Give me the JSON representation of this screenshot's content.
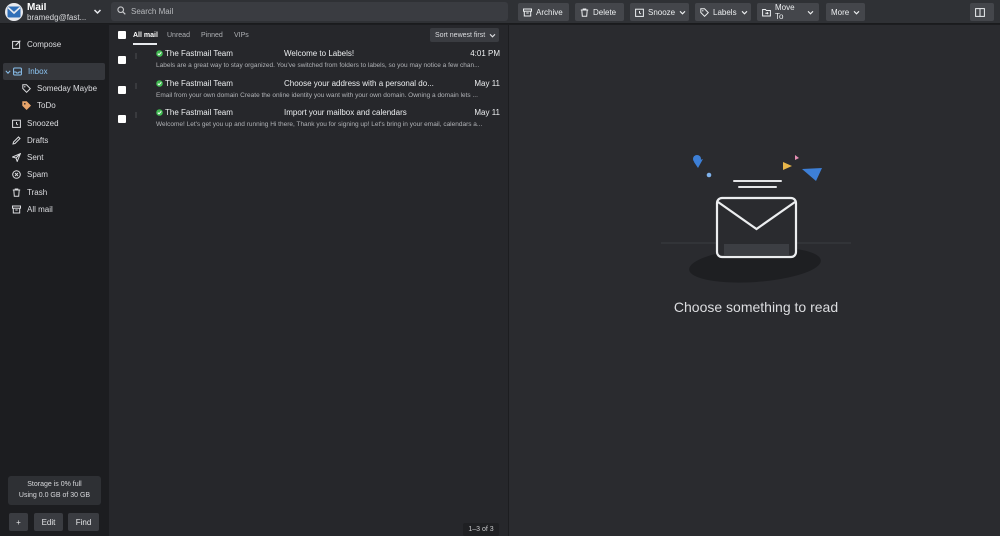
{
  "app": {
    "title": "Mail",
    "account_email": "bramedg@fast..."
  },
  "search": {
    "placeholder": "Search Mail"
  },
  "toolbar": {
    "archive": "Archive",
    "delete": "Delete",
    "snooze": "Snooze",
    "labels": "Labels",
    "move_to": "Move To",
    "more": "More"
  },
  "sidebar": {
    "compose": "Compose",
    "items": [
      {
        "label": "Inbox",
        "icon": "inbox-icon",
        "active": true
      },
      {
        "label": "Someday Maybe",
        "icon": "tag-icon"
      },
      {
        "label": "ToDo",
        "icon": "tag-icon",
        "color": "#e8a46a"
      },
      {
        "label": "Snoozed",
        "icon": "clock-icon"
      },
      {
        "label": "Drafts",
        "icon": "pencil-icon"
      },
      {
        "label": "Sent",
        "icon": "paper-plane-icon"
      },
      {
        "label": "Spam",
        "icon": "spam-icon"
      },
      {
        "label": "Trash",
        "icon": "trash-icon"
      },
      {
        "label": "All mail",
        "icon": "archive-box-icon"
      }
    ],
    "storage_line1": "Storage is 0% full",
    "storage_line2": "Using 0.0 GB of 30 GB",
    "add_button": "+",
    "edit_button": "Edit",
    "find_button": "Find"
  },
  "list": {
    "filters": [
      "All mail",
      "Unread",
      "Pinned",
      "VIPs"
    ],
    "sort_label": "Sort newest first",
    "messages": [
      {
        "sender": "The Fastmail Team",
        "subject": "Welcome to Labels!",
        "date": "4:01 PM",
        "preview": "Labels are a great way to stay organized. You've switched from folders to labels, so you may notice a few chan..."
      },
      {
        "sender": "The Fastmail Team",
        "subject": "Choose your address with a personal do...",
        "date": "May 11",
        "preview": "Email from your own domain Create the online identity you want with your own domain. Owning a domain lets ..."
      },
      {
        "sender": "The Fastmail Team",
        "subject": "Import your mailbox and calendars",
        "date": "May 11",
        "preview": "Welcome! Let's get you up and running Hi there, Thank you for signing up! Let's bring in your email, calendars a..."
      }
    ],
    "page_count": "1–3 of 3"
  },
  "reading": {
    "empty_text": "Choose something to read"
  },
  "colors": {
    "accent": "#8cc4f2",
    "verified": "#3fb950",
    "logo_blue": "#2f6fb8"
  }
}
